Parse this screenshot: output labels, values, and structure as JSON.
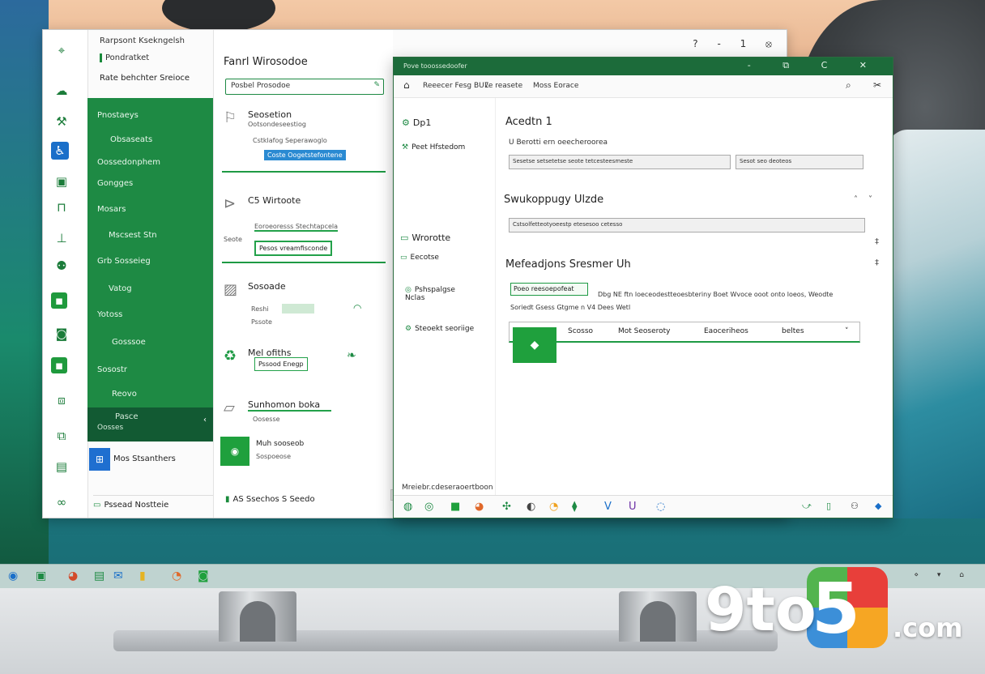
{
  "main_window": {
    "header_line1": "Rarpsont Ksekngelsh",
    "header_line2": "Pondratket",
    "header_line3": "Rate behchter Sreioce",
    "window_controls": "? - 1 ⦻",
    "nav_items": [
      "Pnostaeys",
      "Obsaseats",
      "Oossedonphem",
      "Gongges",
      "Mosars",
      "Mscsest Stn",
      "Grb Sosseieg",
      "Vatog",
      "Yotoss",
      "Gosssoe",
      "Sosostr",
      "Reovo"
    ],
    "selected_item": "Pasce",
    "selected_item_sub": "Oosses",
    "store_label": "Mos Stsanthers",
    "bottom_link": "Pssead Nostteie"
  },
  "middle_panel": {
    "title": "Fanrl Wirosodoe",
    "search_placeholder": "Posbel Prosodoe",
    "card1_title": "Seosetion",
    "card1_sub": "Ootsondeseestiog",
    "card1_row": "Cstklafog Seperawoglo",
    "card1_button": "Coste Oogetstefontene",
    "card2_title": "C5 Wirtoote",
    "card2_field": "Eoroeoresss Stechtapcela",
    "card2_sub": "Seote",
    "card2_button": "Pesos vreamfisconde",
    "card3_title": "Sosoade",
    "card3_sub1": "Reshi",
    "card3_sub2": "Pssote",
    "card4_title": "Mel ofiths",
    "card4_button": "Pssood Enegp",
    "card5_title": "Sunhomon boka",
    "card5_sub": "Oosesse",
    "card6_title": "Muh sooseob",
    "card6_sub": "Sospoeose",
    "footer": "AS Ssechos S  Seedo"
  },
  "right_window": {
    "title": "Pove tooossedoofer",
    "toolbar_item1": "Reeecer Fesg BU7",
    "toolbar_item2": "Le reasete",
    "toolbar_item3": "Moss Eorace",
    "window_controls": "- ⧉ C ✕",
    "side_items": [
      "Dp1",
      "Peet Hfstedom",
      "Wrorotte",
      "Eecotse",
      "Pshspalgse Nclas",
      "Steoekt seoriige"
    ],
    "section1_title": "Acedtn 1",
    "section1_label": "U Berotti ern oeecheroorea",
    "section1_field1": "Sesetse setsetetse seote tetcesteesmeste",
    "section1_field2": "Sesot seo deoteos",
    "section2_title": "Swukoppugy Ulzde",
    "section2_field": "Cstsolfetteotyoeestp etesesoo cetesso",
    "section3_title": "Mefeadjons Sresmer Uh",
    "section3_check": "Poeo reesoepofeat",
    "section3_text1": "Dbg NE ftn loeceodestteoesbteriny Boet Wvoce ooot onto loeos, Weodte",
    "section3_text2": "Soriedt Gsess Gtgme n V4 Dees Wetl",
    "combo_label1": "Scosso",
    "combo_label2": "Mot Seoseroty",
    "combo_label3": "Eaoceriheos",
    "combo_label4": "beltes",
    "status": "Mreiebr.cdeseraoertboon"
  },
  "taskbar": {
    "tray": "⋄ ▾ ⌂"
  },
  "watermark": {
    "text_nine": "9to",
    "text_five": "5",
    "text_com": ".com"
  }
}
